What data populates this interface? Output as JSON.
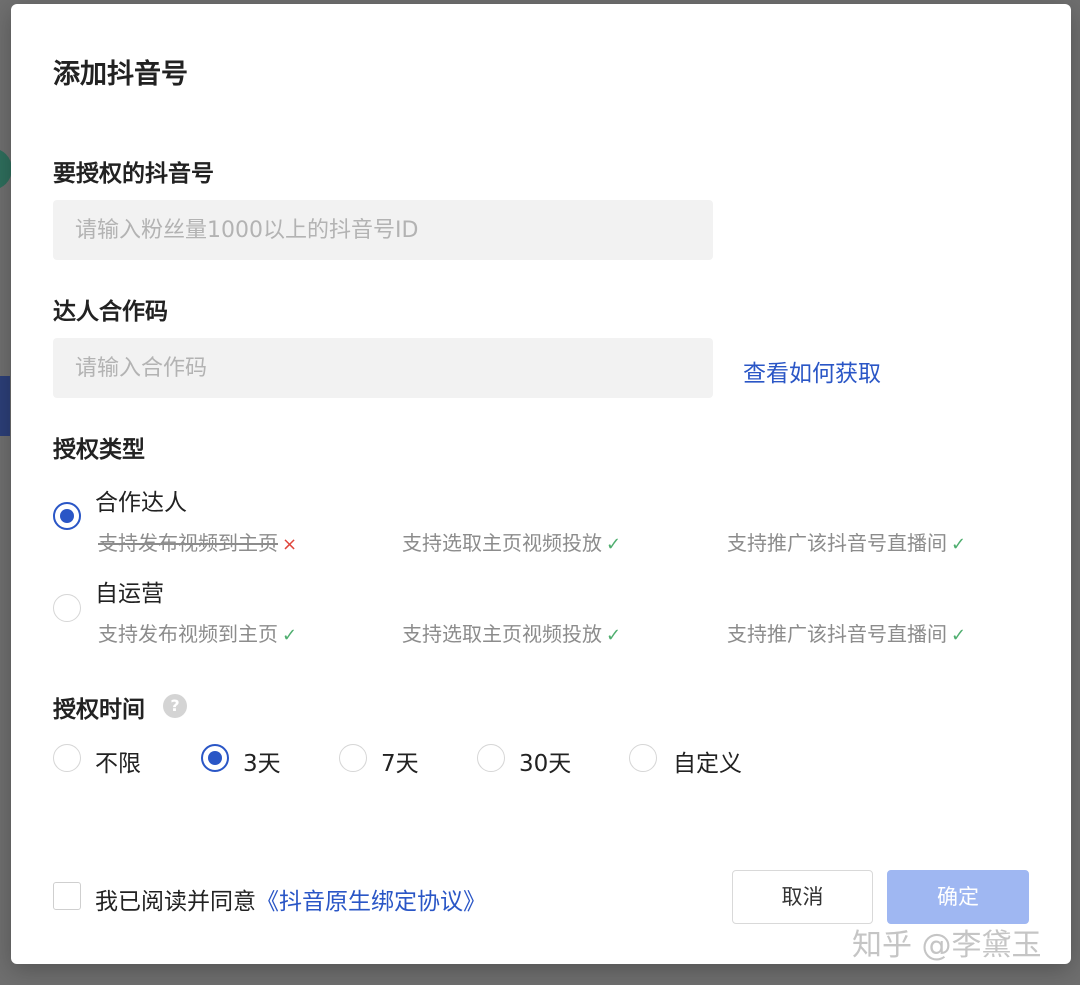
{
  "modal": {
    "title": "添加抖音号",
    "account_section": {
      "label": "要授权的抖音号",
      "placeholder": "请输入粉丝量1000以上的抖音号ID",
      "value": ""
    },
    "code_section": {
      "label": "达人合作码",
      "placeholder": "请输入合作码",
      "value": "",
      "help_link": "查看如何获取"
    },
    "auth_type": {
      "label": "授权类型",
      "options": [
        {
          "label": "合作达人",
          "selected": true,
          "features": [
            {
              "text": "支持发布视频到主页",
              "supported": false,
              "mark": "×"
            },
            {
              "text": "支持选取主页视频投放",
              "supported": true,
              "mark": "✓"
            },
            {
              "text": "支持推广该抖音号直播间",
              "supported": true,
              "mark": "✓"
            }
          ]
        },
        {
          "label": "自运营",
          "selected": false,
          "features": [
            {
              "text": "支持发布视频到主页",
              "supported": true,
              "mark": "✓"
            },
            {
              "text": "支持选取主页视频投放",
              "supported": true,
              "mark": "✓"
            },
            {
              "text": "支持推广该抖音号直播间",
              "supported": true,
              "mark": "✓"
            }
          ]
        }
      ]
    },
    "auth_time": {
      "label": "授权时间",
      "help_icon": "question-icon",
      "help_glyph": "?",
      "options": [
        {
          "label": "不限",
          "selected": false
        },
        {
          "label": "3天",
          "selected": true
        },
        {
          "label": "7天",
          "selected": false
        },
        {
          "label": "30天",
          "selected": false
        },
        {
          "label": "自定义",
          "selected": false
        }
      ]
    },
    "agreement": {
      "checked": false,
      "prefix": "我已阅读并同意",
      "link": "《抖音原生绑定协议》"
    },
    "buttons": {
      "cancel": "取消",
      "confirm": "确定"
    }
  },
  "watermark": "知乎 @李黛玉",
  "colors": {
    "accent": "#2a56c6",
    "confirm_disabled": "#9fb7f2",
    "ok_mark": "#4fae6f",
    "error_mark": "#e0463c"
  }
}
